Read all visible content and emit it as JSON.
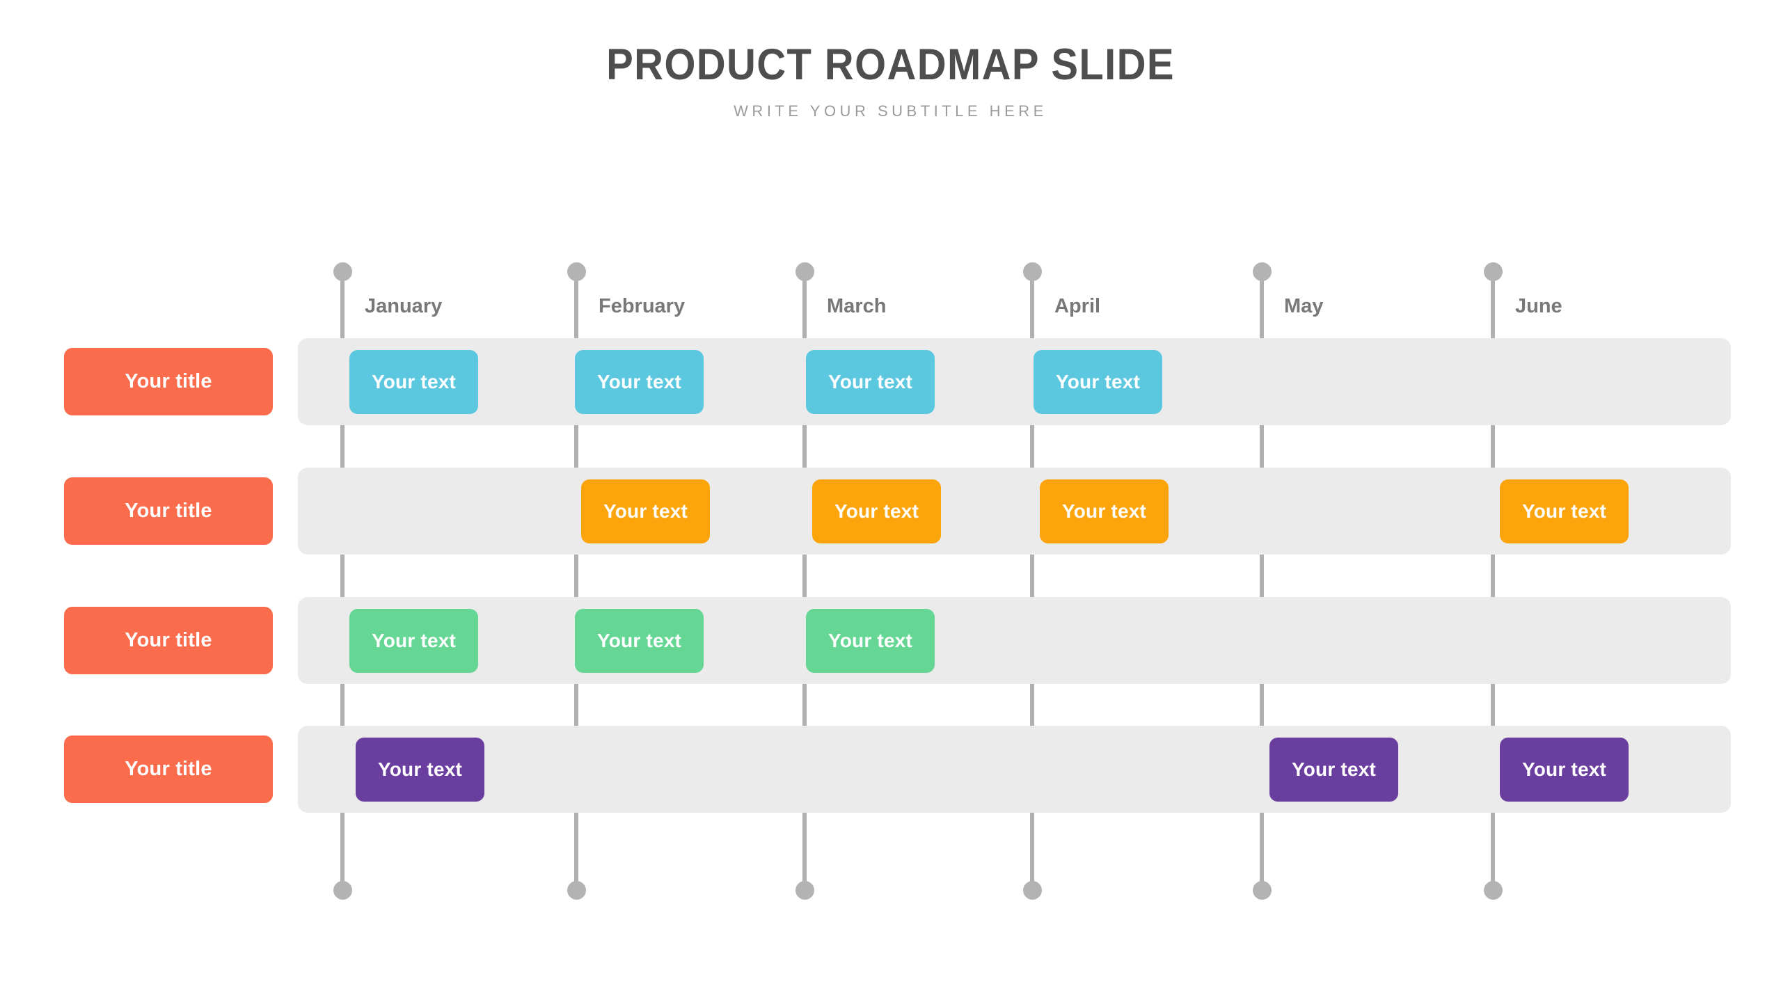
{
  "header": {
    "title": "PRODUCT ROADMAP SLIDE",
    "subtitle": "WRITE YOUR SUBTITLE HERE"
  },
  "timeline": {
    "months": [
      {
        "label": "January"
      },
      {
        "label": "February"
      },
      {
        "label": "March"
      },
      {
        "label": "April"
      },
      {
        "label": "May"
      },
      {
        "label": "June"
      }
    ],
    "line_color": "#b0b0b0",
    "marker_color": "#b3b3b3",
    "track_color": "#ebebeb"
  },
  "rows": [
    {
      "title": "Your title",
      "title_color": "#fb6c4c",
      "bar_color": "#5bc8e0",
      "bars": [
        {
          "label": "Your text",
          "month": "January"
        },
        {
          "label": "Your text",
          "month": "February"
        },
        {
          "label": "Your text",
          "month": "March"
        },
        {
          "label": "Your text",
          "month": "April"
        }
      ]
    },
    {
      "title": "Your title",
      "title_color": "#fb6c4c",
      "bar_color": "#fba40b",
      "bars": [
        {
          "label": "Your text",
          "month": "February"
        },
        {
          "label": "Your text",
          "month": "March"
        },
        {
          "label": "Your text",
          "month": "April"
        },
        {
          "label": "Your text",
          "month": "June"
        }
      ]
    },
    {
      "title": "Your title",
      "title_color": "#fb6c4c",
      "bar_color": "#66d694",
      "bars": [
        {
          "label": "Your text",
          "month": "January"
        },
        {
          "label": "Your text",
          "month": "February"
        },
        {
          "label": "Your text",
          "month": "March"
        }
      ]
    },
    {
      "title": "Your title",
      "title_color": "#fb6c4c",
      "bar_color": "#6a3e9e",
      "bars": [
        {
          "label": "Your text",
          "month": "January"
        },
        {
          "label": "Your text",
          "month": "May"
        },
        {
          "label": "Your text",
          "month": "June"
        }
      ]
    }
  ]
}
